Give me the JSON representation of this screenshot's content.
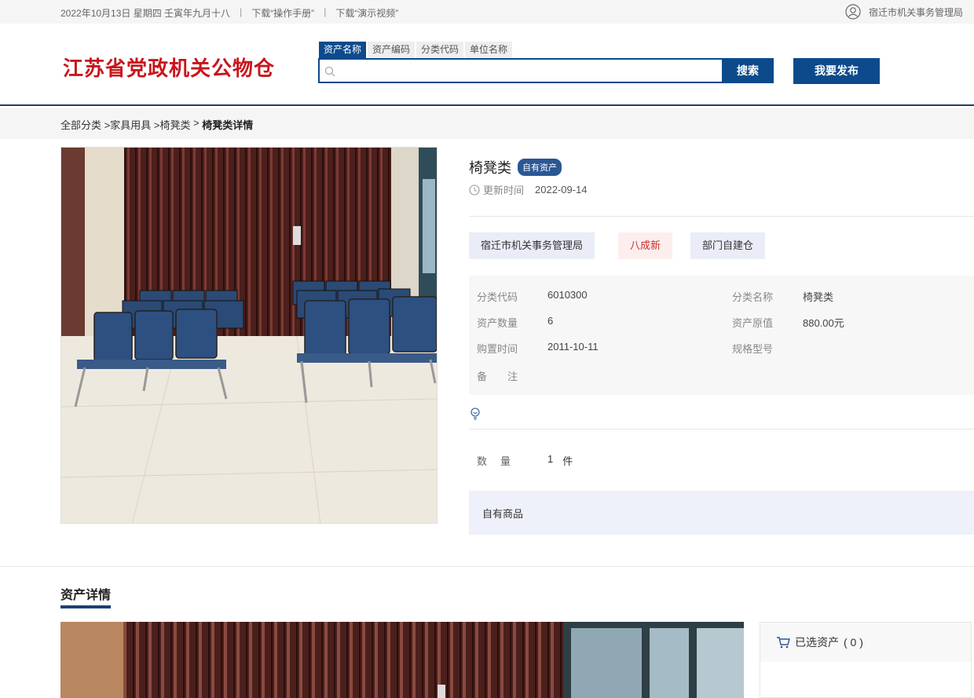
{
  "topbar": {
    "date": "2022年10月13日 星期四 壬寅年九月十八",
    "separator": "|",
    "manual_link": "下载“操作手册”",
    "video_link": "下载“演示视频”",
    "org_name": "宿迁市机关事务管理局"
  },
  "header": {
    "logo_text": "江苏省党政机关公物仓",
    "search_tabs": [
      "资产名称",
      "资产编码",
      "分类代码",
      "单位名称"
    ],
    "search_placeholder": "",
    "search_button": "搜索",
    "publish_button": "我要发布"
  },
  "breadcrumb": {
    "items": [
      "全部分类",
      ">家具用具",
      ">椅凳类",
      ">"
    ],
    "current": "椅凳类详情"
  },
  "product": {
    "title": "椅凳类",
    "badge": "自有资产",
    "update_label": "更新时间",
    "update_value": "2022-09-14",
    "tags": {
      "org": "宿迁市机关事务管理局",
      "condition": "八成新",
      "warehouse": "部门自建仓"
    },
    "specs": {
      "class_code_label": "分类代码",
      "class_code_value": "6010300",
      "class_name_label": "分类名称",
      "class_name_value": "椅凳类",
      "asset_qty_label": "资产数量",
      "asset_qty_value": "6",
      "original_value_label": "资产原值",
      "original_value_value": "880.00元",
      "purchase_time_label": "购置时间",
      "purchase_time_value": "2011-10-11",
      "spec_model_label": "规格型号",
      "spec_model_value": "",
      "remark_label": "备　　注",
      "remark_value": ""
    },
    "quantity_label": "数　量",
    "quantity_value": "1",
    "quantity_unit": "件",
    "own_goods": "自有商品"
  },
  "details": {
    "section_title": "资产详情"
  },
  "cart": {
    "label": "已选资产",
    "count_text": "( 0 )"
  },
  "colors": {
    "primary": "#0c4a8c",
    "logo_red": "#c8161d",
    "condition_red": "#c9302c"
  }
}
